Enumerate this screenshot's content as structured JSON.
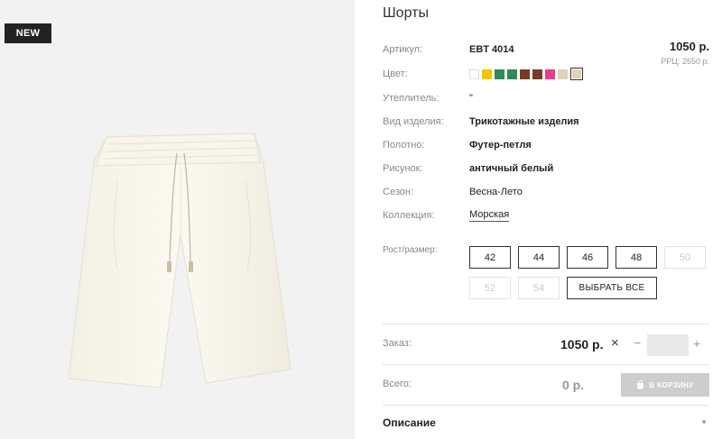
{
  "badge": "NEW",
  "product": {
    "title": "Шорты",
    "price": "1050 р.",
    "rrp": "РРЦ: 2650 р."
  },
  "details": [
    {
      "label": "Артикул:",
      "value": "EBT 4014",
      "style": "bold"
    },
    {
      "label": "Цвет:",
      "value": "",
      "style": "swatches"
    },
    {
      "label": "Утеплитель:",
      "value": "\"",
      "style": "plain"
    },
    {
      "label": "Вид изделия:",
      "value": "Трикотажные изделия",
      "style": "bold"
    },
    {
      "label": "Полотно:",
      "value": "Футер-петля",
      "style": "bold"
    },
    {
      "label": "Рисунок:",
      "value": "античный белый",
      "style": "bold"
    },
    {
      "label": "Сезон:",
      "value": "Весна-Лето",
      "style": "plain"
    },
    {
      "label": "Коллекция:",
      "value": "Морская",
      "style": "link"
    }
  ],
  "swatches": [
    "#ffffff",
    "#f2c500",
    "#2e8b57",
    "#2e8b57",
    "#7a3b24",
    "#7a3b24",
    "#e83e8c",
    "#e0d2b8",
    "#e0d2b8"
  ],
  "selected_swatch": 8,
  "sizes": {
    "label": "Рост/размер:",
    "options": [
      {
        "label": "42",
        "available": true
      },
      {
        "label": "44",
        "available": true
      },
      {
        "label": "46",
        "available": true
      },
      {
        "label": "48",
        "available": true
      },
      {
        "label": "50",
        "available": false
      },
      {
        "label": "52",
        "available": false
      },
      {
        "label": "54",
        "available": false
      }
    ],
    "select_all": "ВЫБРАТЬ ВСЕ"
  },
  "order": {
    "label": "Заказ:",
    "price": "1050 р.",
    "times": "×",
    "minus": "−",
    "plus": "+",
    "quantity": ""
  },
  "total": {
    "label": "Всего:",
    "value": "0 р.",
    "cart_button": "В КОРЗИНУ"
  },
  "description": {
    "label": "Описание",
    "arrow": "▼"
  }
}
